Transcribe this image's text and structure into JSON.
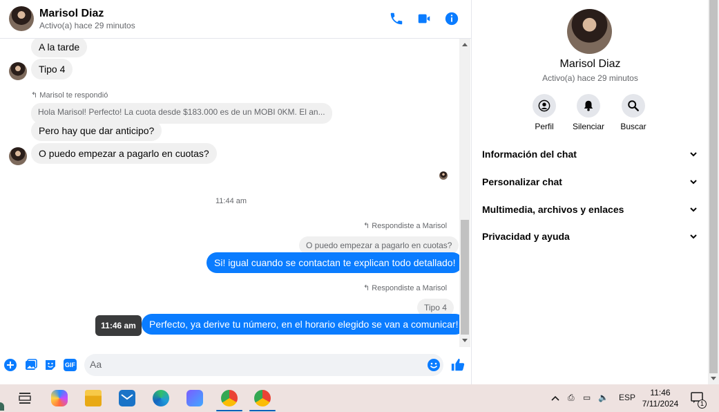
{
  "contact": {
    "name": "Marisol Diaz",
    "status": "Activo(a) hace 29 minutos"
  },
  "messages": {
    "m1": "A la tarde",
    "m2": "Tipo 4",
    "reply_header_in": "Marisol te respondió",
    "quoted_in": "Hola Marisol! Perfecto! La cuota desde $183.000 es de un MOBI 0KM. El an...",
    "m3": "Pero hay que dar anticipo?",
    "m4": "O puedo empezar a pagarlo en cuotas?",
    "timestamp": "11:44 am",
    "reply_header_out_1": "Respondiste a Marisol",
    "quoted_out_1": "O puedo empezar a pagarlo en cuotas?",
    "m5": "Si! igual cuando se contactan te explican todo detallado!",
    "reply_header_out_2": "Respondiste a Marisol",
    "quoted_out_2": "Tipo 4",
    "m6": "Perfecto, ya derive tu número,  en el horario elegido se van a comunicar!",
    "tooltip_time": "11:46 am"
  },
  "composer": {
    "placeholder": "Aa",
    "gif_label": "GIF"
  },
  "side": {
    "actions": [
      {
        "label": "Perfil",
        "icon": "profile-icon"
      },
      {
        "label": "Silenciar",
        "icon": "bell-icon"
      },
      {
        "label": "Buscar",
        "icon": "search-icon"
      }
    ],
    "sections": [
      "Información del chat",
      "Personalizar chat",
      "Multimedia, archivos y enlaces",
      "Privacidad y ayuda"
    ]
  },
  "taskbar": {
    "lang": "ESP",
    "time": "11:46",
    "date": "7/11/2024",
    "notification_count": "1"
  },
  "colors": {
    "accent": "#0a7cff",
    "bubble_in": "#f0f0f0",
    "taskbar": "#eee2e0"
  }
}
